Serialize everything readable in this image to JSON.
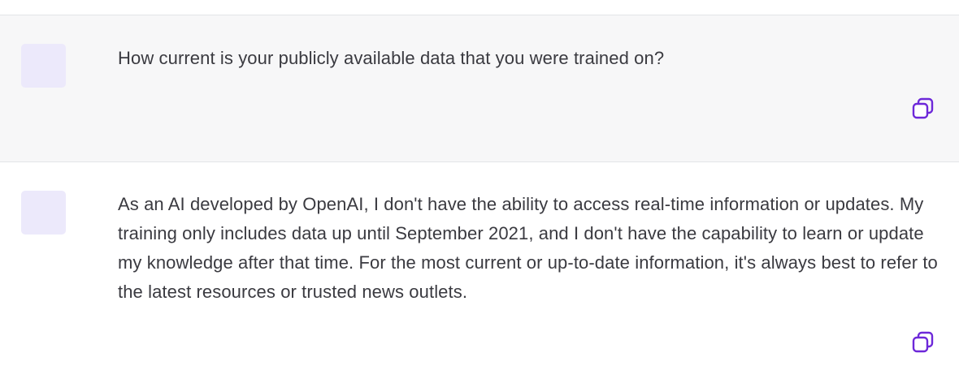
{
  "conversation": {
    "messages": [
      {
        "role": "user",
        "text": "How current is your publicly available data that you were trained on?"
      },
      {
        "role": "assistant",
        "text": "As an AI developed by OpenAI, I don't have the ability to access real-time information or updates. My training only includes data up until September 2021, and I don't have the capability to learn or update my knowledge after that time. For the most current or up-to-date information, it's always best to refer to the latest resources or trusted news outlets."
      }
    ]
  },
  "colors": {
    "user_bg": "#f7f7f8",
    "avatar_bg": "#ece9fb",
    "accent": "#6d28d9",
    "text": "#3a3a40"
  },
  "icons": {
    "copy": "copy-icon",
    "avatar": "avatar"
  }
}
